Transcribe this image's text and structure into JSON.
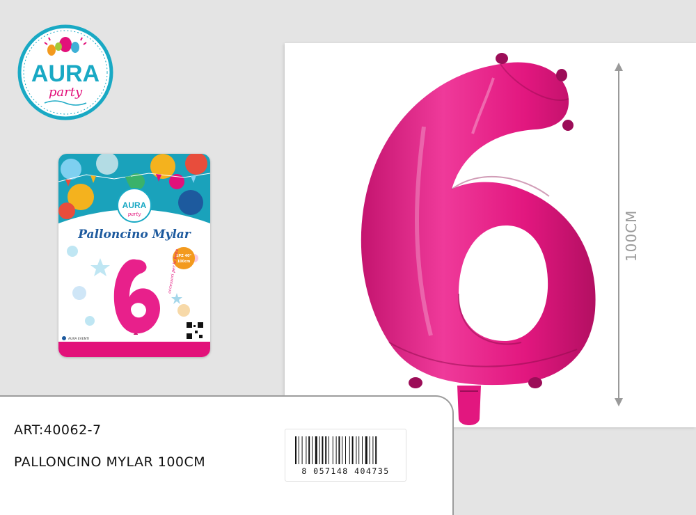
{
  "brand": {
    "name": "AURA",
    "tagline": "party",
    "colors": {
      "teal": "#19a9c4",
      "pink": "#e2117a",
      "navy": "#1d5a9e"
    }
  },
  "package": {
    "title": "Palloncino Mylar",
    "size_badge": [
      "1PZ 40\"",
      "100cm"
    ],
    "footer_social": "AURA EVENTI",
    "side_script": "accessori per le feste"
  },
  "product_photo": {
    "digit": "6",
    "balloon_color": "#e8208b",
    "height_label": "100CM"
  },
  "info": {
    "art_code": "ART:40062-7",
    "product_name": "PALLONCINO MYLAR 100CM",
    "barcode_digits": "8 057148 404735"
  }
}
